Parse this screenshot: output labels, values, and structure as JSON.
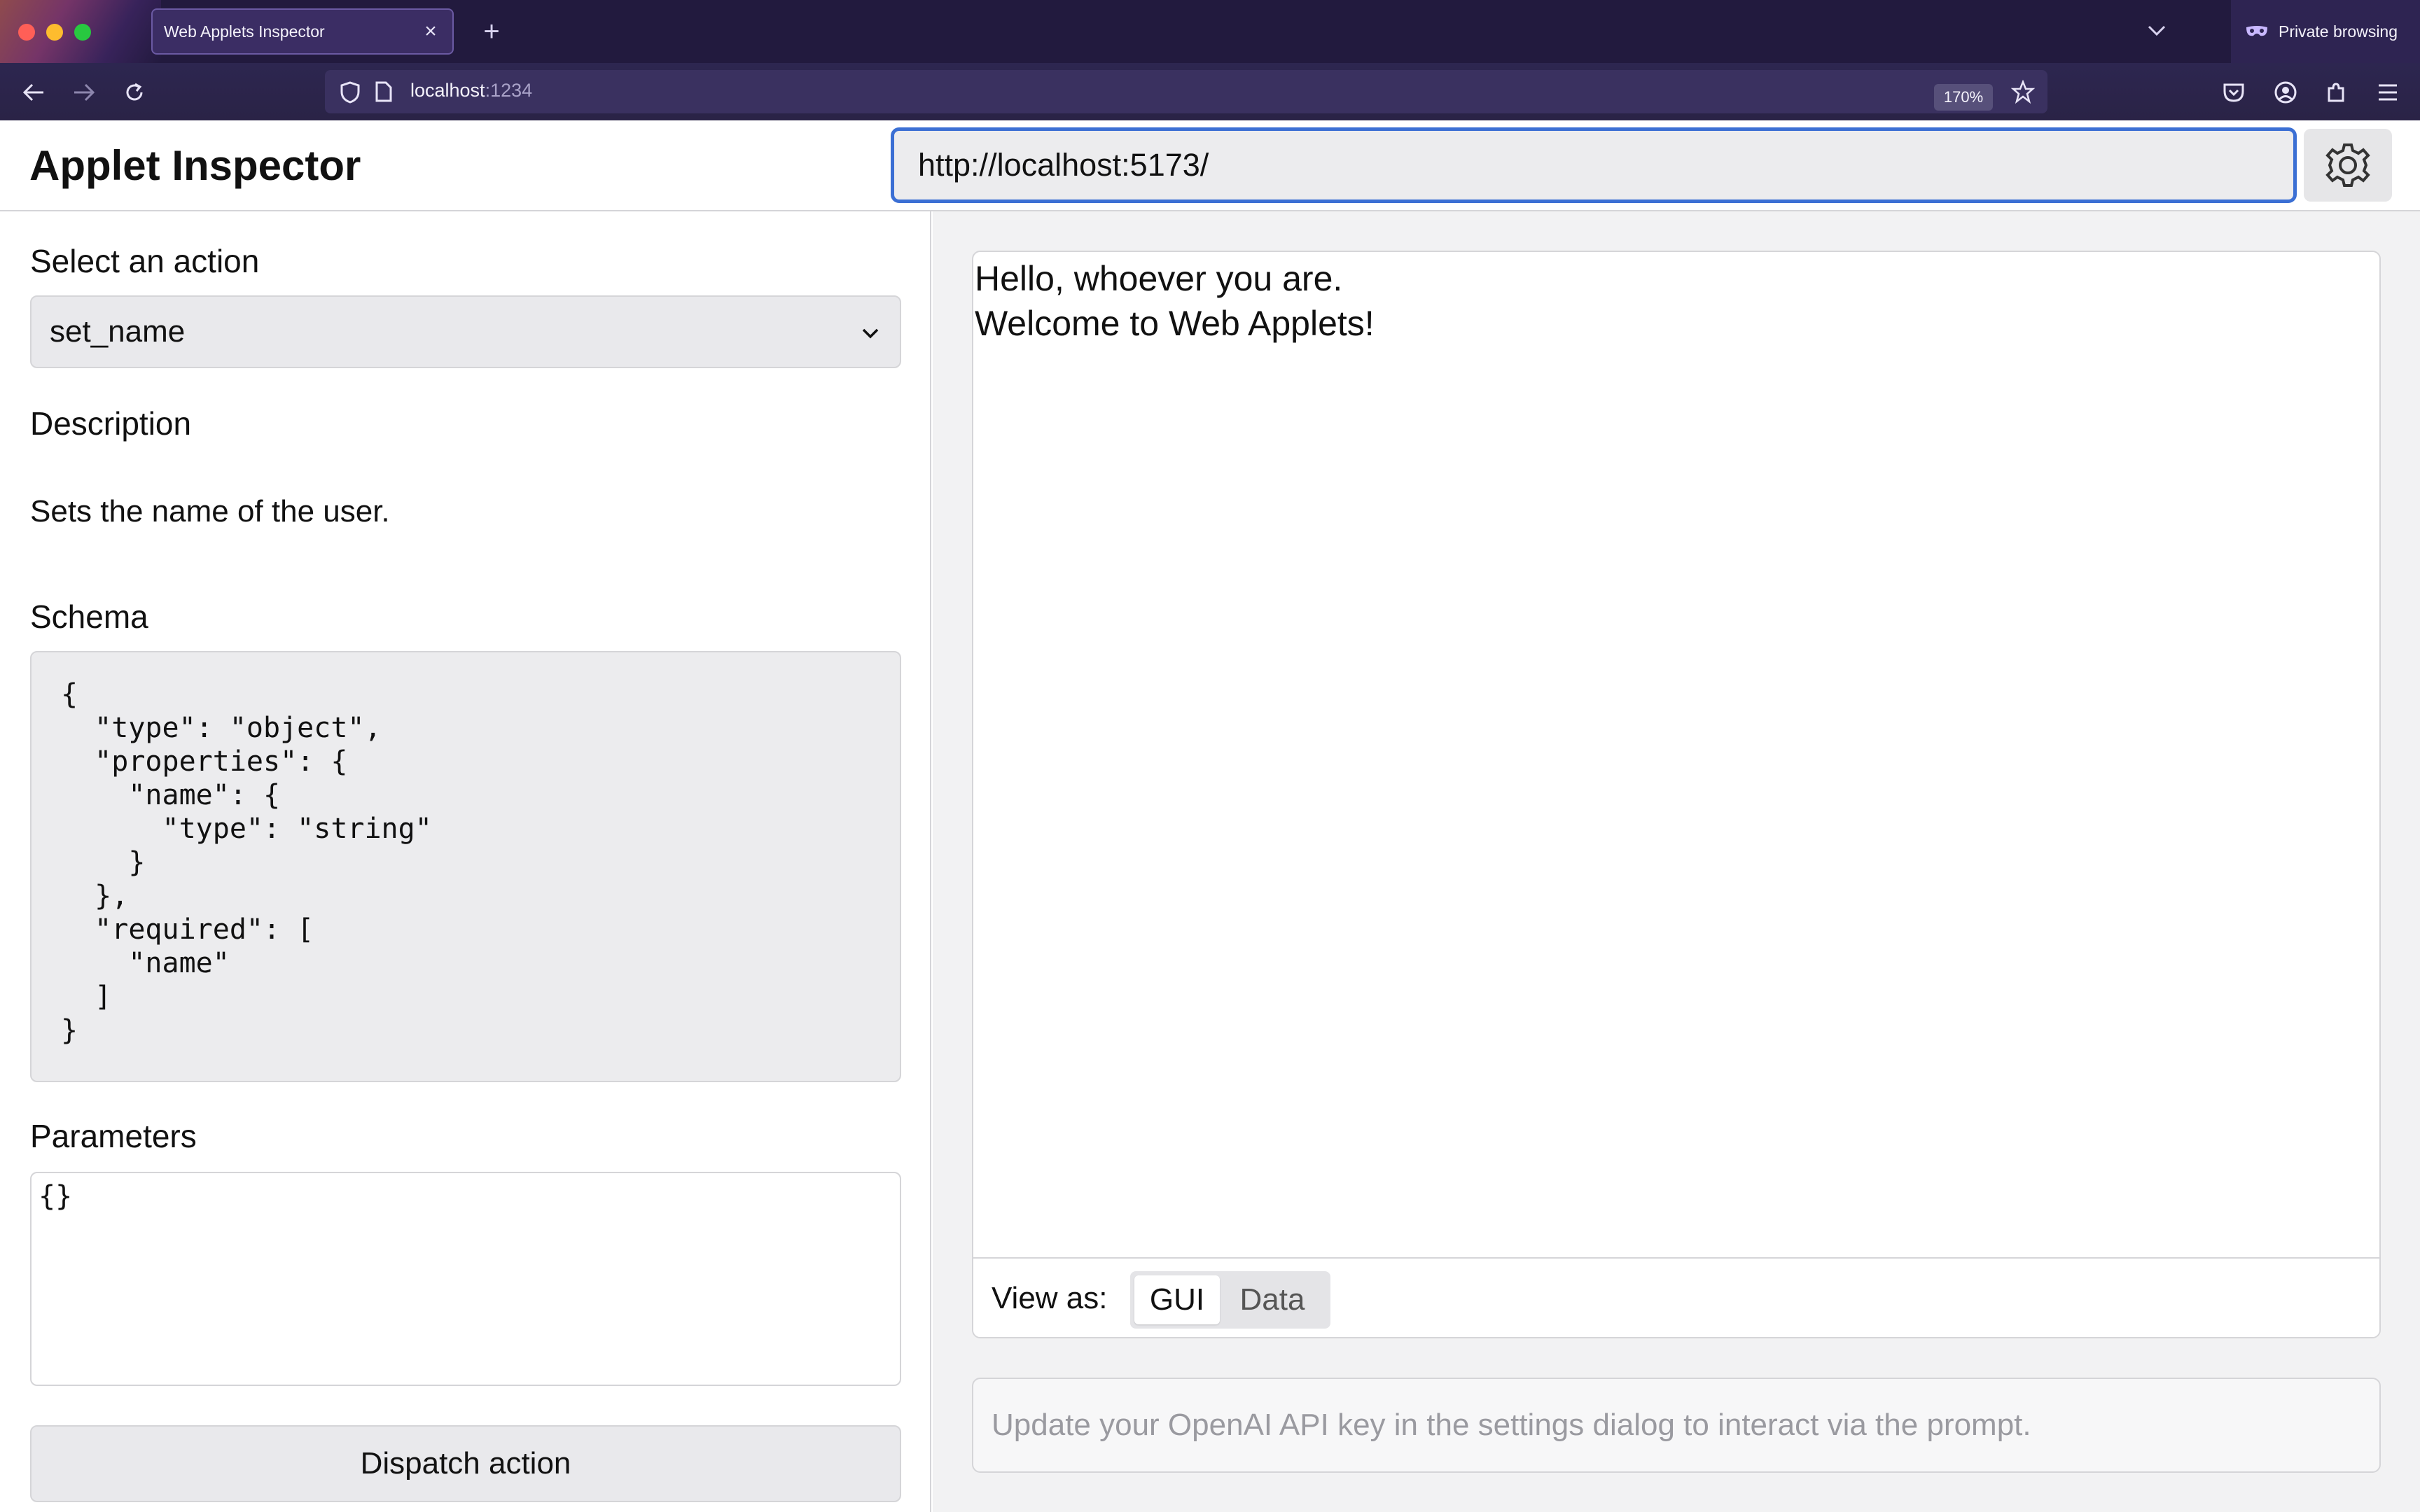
{
  "browser": {
    "tab_title": "Web Applets Inspector",
    "tab_close": "×",
    "new_tab": "+",
    "url_host": "localhost",
    "url_port": ":1234",
    "zoom": "170%",
    "private_label": "Private browsing"
  },
  "header": {
    "title": "Applet Inspector",
    "applet_url": "http://localhost:5173/"
  },
  "left": {
    "action_label": "Select an action",
    "selected_action": "set_name",
    "description_label": "Description",
    "description_text": "Sets the name of the user.",
    "schema_label": "Schema",
    "schema_text": "{\n  \"type\": \"object\",\n  \"properties\": {\n    \"name\": {\n      \"type\": \"string\"\n    }\n  },\n  \"required\": [\n    \"name\"\n  ]\n}",
    "parameters_label": "Parameters",
    "parameters_value": "{}",
    "dispatch_label": "Dispatch action"
  },
  "right": {
    "applet_lines": [
      "Hello, whoever you are.",
      "Welcome to Web Applets!"
    ],
    "view_as_label": "View as:",
    "view_modes": [
      "GUI",
      "Data"
    ],
    "active_view": "GUI",
    "prompt_placeholder": "Update your OpenAI API key in the settings dialog to interact via the prompt."
  },
  "colors": {
    "accent_focus": "#3b6fd4",
    "chrome_bg": "#221a3e"
  },
  "icons": [
    "back-arrow-icon",
    "forward-arrow-icon",
    "reload-icon",
    "shield-icon",
    "page-icon",
    "star-icon",
    "pocket-icon",
    "account-icon",
    "extensions-icon",
    "menu-icon",
    "private-mask-icon",
    "gear-icon",
    "chevron-down-icon"
  ]
}
